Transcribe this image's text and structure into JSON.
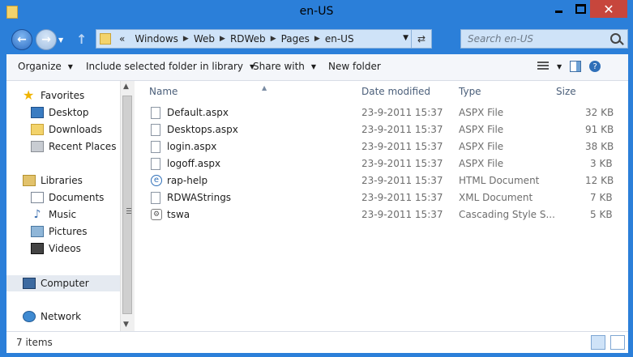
{
  "window": {
    "title": "en-US"
  },
  "nav": {
    "breadcrumbs": [
      "Windows",
      "Web",
      "RDWeb",
      "Pages",
      "en-US"
    ],
    "overflow_label": "«",
    "search_placeholder": "Search en-US"
  },
  "commands": {
    "organize": "Organize",
    "include": "Include selected folder in library",
    "share": "Share with",
    "new_folder": "New folder"
  },
  "sidebar": {
    "favorites": "Favorites",
    "favorites_items": [
      "Desktop",
      "Downloads",
      "Recent Places"
    ],
    "libraries": "Libraries",
    "libraries_items": [
      "Documents",
      "Music",
      "Pictures",
      "Videos"
    ],
    "computer": "Computer",
    "network": "Network"
  },
  "columns": {
    "name": "Name",
    "date": "Date modified",
    "type": "Type",
    "size": "Size"
  },
  "files": [
    {
      "name": "Default.aspx",
      "date": "23-9-2011 15:37",
      "type": "ASPX File",
      "size": "32 KB",
      "icon": "aspx-file-icon"
    },
    {
      "name": "Desktops.aspx",
      "date": "23-9-2011 15:37",
      "type": "ASPX File",
      "size": "91 KB",
      "icon": "aspx-file-icon"
    },
    {
      "name": "login.aspx",
      "date": "23-9-2011 15:37",
      "type": "ASPX File",
      "size": "38 KB",
      "icon": "aspx-file-icon"
    },
    {
      "name": "logoff.aspx",
      "date": "23-9-2011 15:37",
      "type": "ASPX File",
      "size": "3 KB",
      "icon": "aspx-file-icon"
    },
    {
      "name": "rap-help",
      "date": "23-9-2011 15:37",
      "type": "HTML Document",
      "size": "12 KB",
      "icon": "html-document-icon"
    },
    {
      "name": "RDWAStrings",
      "date": "23-9-2011 15:37",
      "type": "XML Document",
      "size": "7 KB",
      "icon": "xml-document-icon"
    },
    {
      "name": "tswa",
      "date": "23-9-2011 15:37",
      "type": "Cascading Style S...",
      "size": "5 KB",
      "icon": "css-file-icon"
    }
  ],
  "status": {
    "items": "7 items"
  },
  "colors": {
    "frame": "#2b7fd9",
    "close": "#c7463c",
    "address": "#cfe3f8"
  }
}
